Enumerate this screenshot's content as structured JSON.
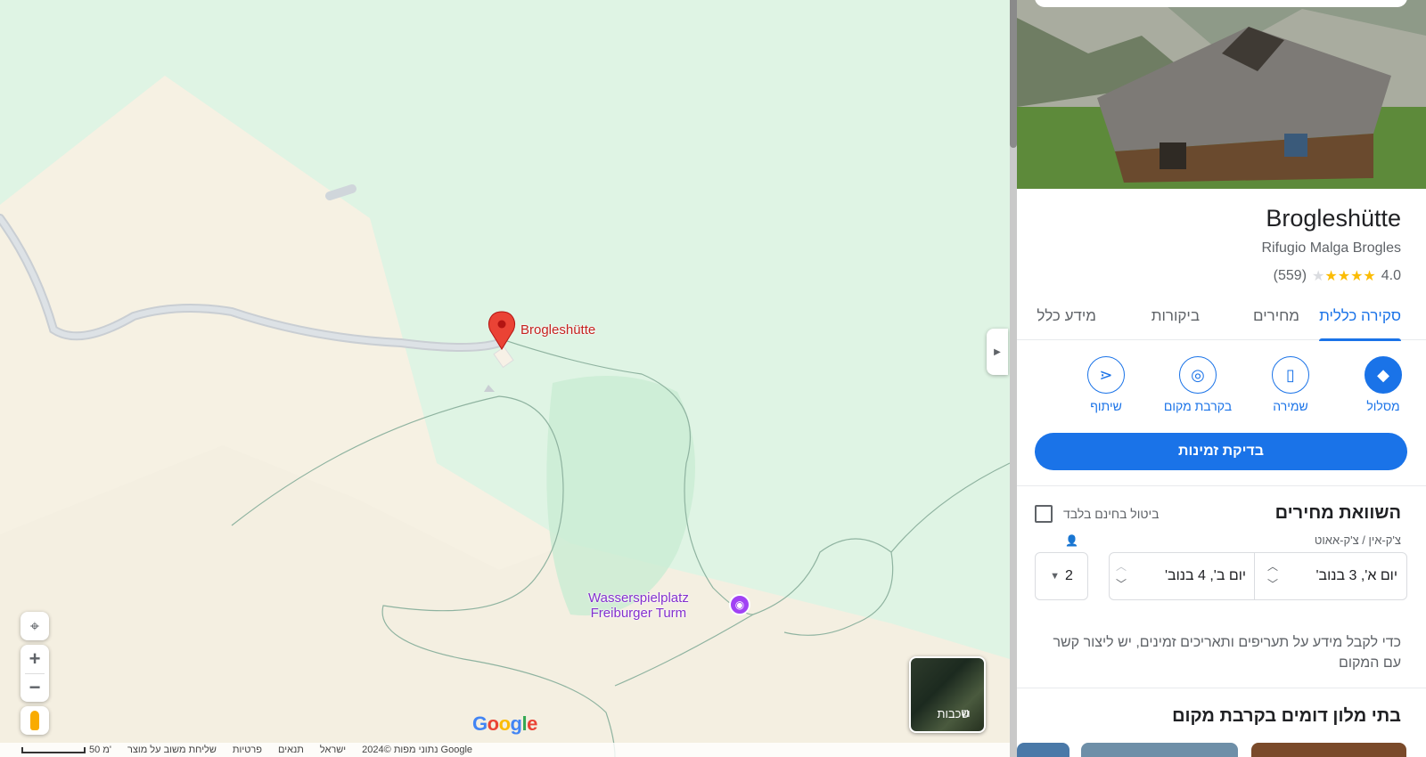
{
  "map": {
    "pin_label": "Brogleshütte",
    "poi_label_line1": "Wasserspielplatz",
    "poi_label_line2": "Freiburger Turm",
    "layers_label": "שכבות",
    "logo_text": "Google",
    "footer": {
      "data": "נתוני מפות ©2024 Google",
      "country": "ישראל",
      "terms": "תנאים",
      "privacy": "פרטיות",
      "feedback": "שליחת משוב על מוצר",
      "scale": "50 מ'"
    }
  },
  "place": {
    "title": "Brogleshütte",
    "subtitle": "Rifugio Malga Brogles",
    "rating": "4.0",
    "stars": 4,
    "review_count": "(559)"
  },
  "tabs": [
    "סקירה כללית",
    "מחירים",
    "ביקורות",
    "מידע כלל"
  ],
  "actions": {
    "route": "מסלול",
    "save": "שמירה",
    "nearby": "בקרבת מקום",
    "share": "שיתוף"
  },
  "check_availability": "בדיקת זמינות",
  "prices": {
    "title": "השוואת מחירים",
    "free_cancel": "ביטול בחינם בלבד",
    "dates_label": "צ'ק-אין / צ'ק-אאוט",
    "check_in": "יום א', 3 בנוב'",
    "check_out": "יום ב', 4 בנוב'",
    "guests": "2",
    "contact_note": "כדי לקבל מידע על תעריפים ותאריכים זמינים, יש ליצור קשר עם המקום"
  },
  "similar_hotels_title": "בתי מלון דומים בקרבת מקום",
  "colors": {
    "accent": "#1a73e8",
    "pin": "#ea4335",
    "poi": "#a142f4",
    "map_green": "#dff4e4",
    "map_beige": "#f4efe1"
  }
}
